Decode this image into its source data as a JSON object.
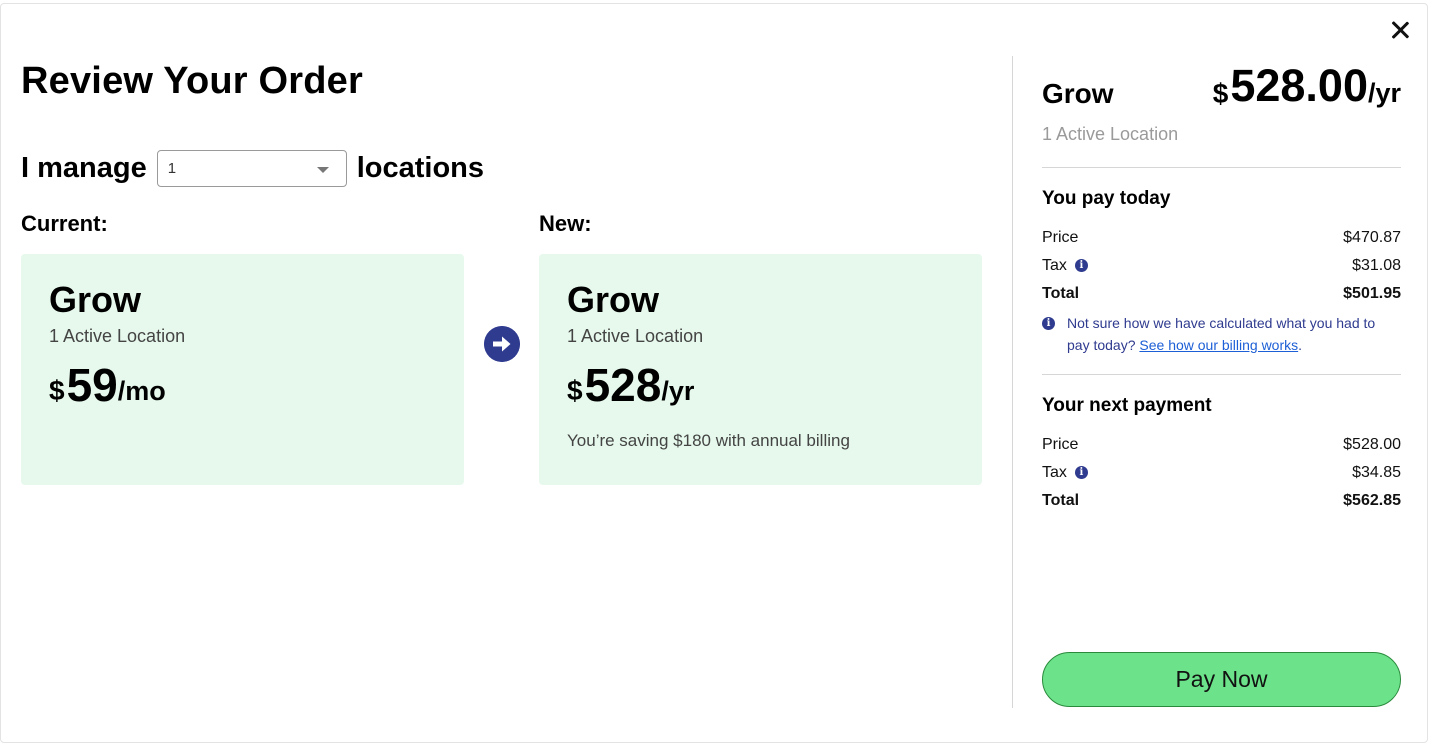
{
  "dialog": {
    "title": "Review Your Order"
  },
  "manage": {
    "prefix": "I manage",
    "selected_value": "1",
    "suffix": "locations"
  },
  "current": {
    "label": "Current:",
    "plan_name": "Grow",
    "locations": "1 Active Location",
    "currency": "$",
    "amount": "59",
    "period": "/mo"
  },
  "new_plan": {
    "label": "New:",
    "plan_name": "Grow",
    "locations": "1 Active Location",
    "currency": "$",
    "amount": "528",
    "period": "/yr",
    "savings": "You’re saving $180 with annual billing"
  },
  "summary": {
    "plan_name": "Grow",
    "currency": "$",
    "amount": "528.00",
    "period": "/yr",
    "locations": "1 Active Location",
    "today": {
      "title": "You pay today",
      "price_label": "Price",
      "price_value": "$470.87",
      "tax_label": "Tax",
      "tax_value": "$31.08",
      "total_label": "Total",
      "total_value": "$501.95",
      "note_text": "Not sure how we have calculated what you had to pay today?",
      "note_link": "See how our billing works",
      "note_end": "."
    },
    "next": {
      "title": "Your next payment",
      "price_label": "Price",
      "price_value": "$528.00",
      "tax_label": "Tax",
      "tax_value": "$34.85",
      "total_label": "Total",
      "total_value": "$562.85"
    }
  },
  "pay_button": {
    "label": "Pay Now"
  },
  "colors": {
    "card_bg": "#e6f9ec",
    "accent": "#2f3b8f",
    "button": "#6ce38a",
    "button_border": "#2a8a3c",
    "link": "#1d5fd6"
  }
}
